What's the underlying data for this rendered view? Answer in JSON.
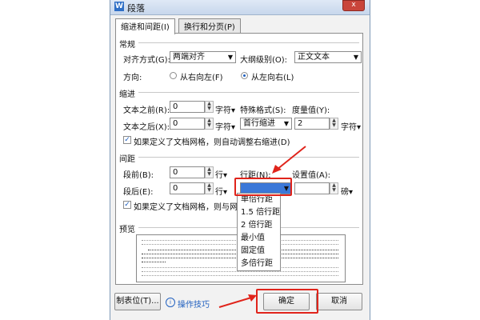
{
  "window": {
    "icon": "W",
    "title": "段落",
    "close": "x"
  },
  "tabs": [
    "缩进和间距(I)",
    "换行和分页(P)"
  ],
  "general": {
    "heading": "常规",
    "align_label": "对齐方式(G):",
    "align_value": "两端对齐",
    "outline_label": "大纲级别(O):",
    "outline_value": "正文文本",
    "direction_label": "方向:",
    "rtl_label": "从右向左(F)",
    "ltr_label": "从左向右(L)"
  },
  "indent": {
    "heading": "缩进",
    "before_label": "文本之前(R):",
    "before_value": "0",
    "before_unit": "字符",
    "after_label": "文本之后(X):",
    "after_value": "0",
    "after_unit": "字符",
    "special_label": "特殊格式(S):",
    "special_value": "首行缩进",
    "measure_label": "度量值(Y):",
    "measure_value": "2",
    "measure_unit": "字符",
    "grid_check_label": "如果定义了文档网格，则自动调整右缩进(D)"
  },
  "spacing": {
    "heading": "间距",
    "before_label": "段前(B):",
    "before_value": "0",
    "before_unit": "行",
    "after_label": "段后(E):",
    "after_value": "0",
    "after_unit": "行",
    "line_label": "行距(N):",
    "line_value": "",
    "setting_label": "设置值(A):",
    "setting_unit": "磅",
    "grid_check_label": "如果定义了文档网格，则与网格对"
  },
  "line_spacing_options": [
    "单倍行距",
    "1.5 倍行距",
    "2 倍行距",
    "最小值",
    "固定值",
    "多倍行距"
  ],
  "preview": {
    "heading": "预览"
  },
  "footer": {
    "tabs_button": "制表位(T)...",
    "tips_link": "操作技巧",
    "ok_button": "确定",
    "cancel_button": "取消"
  },
  "colors": {
    "highlight": "#e0241b",
    "link": "#1f5fbf"
  }
}
